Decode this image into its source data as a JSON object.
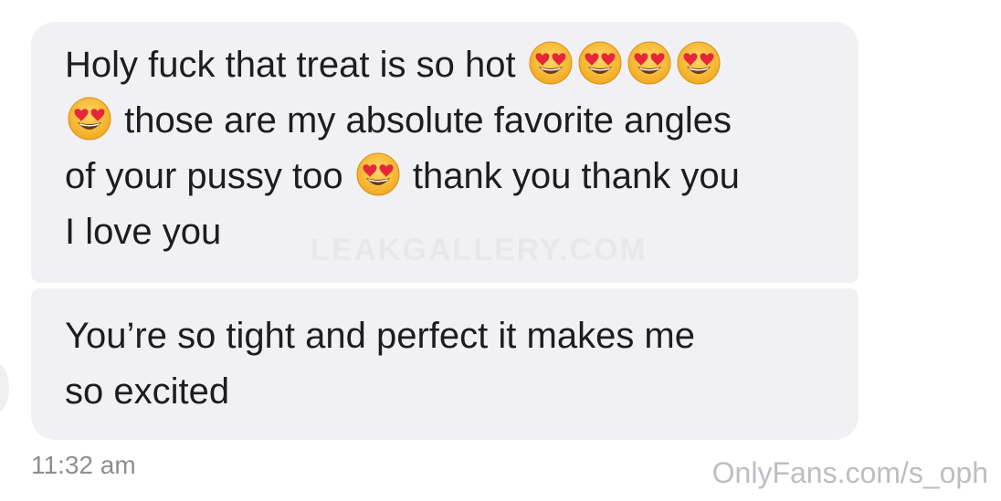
{
  "messages": [
    {
      "lines": [
        {
          "text": "Holy fuck that treat is so hot",
          "emojis_after": 4
        },
        {
          "emoji_before": 1,
          "text": "those are my absolute favorite angles"
        },
        {
          "text_a": "of your pussy too",
          "emoji_mid": 1,
          "text_b": "thank you thank you"
        },
        {
          "text": "I love you"
        }
      ]
    },
    {
      "lines": [
        {
          "text": "You’re so tight and perfect it makes me"
        },
        {
          "text": "so excited"
        }
      ]
    }
  ],
  "emoji_name": "heart-eyes",
  "timestamp": "11:32 am",
  "background_watermark": "LEAKGALLERY.COM",
  "watermark": "OnlyFans.com/s_oph",
  "colors": {
    "bubble": "#f1f1f4",
    "text": "#1d1d1f",
    "timestamp": "#8e8e93",
    "watermark": "#bdbdc2"
  }
}
